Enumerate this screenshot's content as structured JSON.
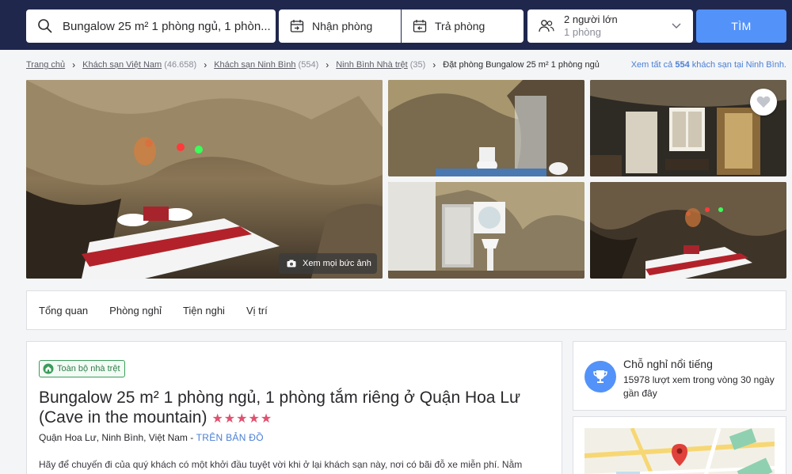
{
  "search": {
    "destination": "Bungalow 25 m² 1 phòng ngủ, 1 phòn...",
    "checkin_label": "Nhận phòng",
    "checkout_label": "Trả phòng",
    "guests_line1": "2 người lớn",
    "guests_line2": "1 phòng",
    "search_button": "TÌM",
    "icons": {
      "search": "search-icon",
      "calendar": "calendar-icon",
      "guests": "guests-icon",
      "dropdown": "chevron-down-icon"
    }
  },
  "breadcrumb": {
    "items": [
      {
        "label": "Trang chủ",
        "count": ""
      },
      {
        "label": "Khách sạn Việt Nam",
        "count": "(46.658)"
      },
      {
        "label": "Khách sạn Ninh Bình",
        "count": "(554)"
      },
      {
        "label": "Ninh Bình Nhà trệt",
        "count": "(35)"
      }
    ],
    "current": "Đặt phòng Bungalow 25 m² 1 phòng ngủ",
    "see_all_prefix": "Xem tất cả",
    "see_all_count": "554",
    "see_all_suffix": "khách sạn tại Ninh Bình."
  },
  "gallery": {
    "see_all_photos": "Xem mọi bức ảnh",
    "favorite_icon": "heart-icon",
    "camera_icon": "camera-icon"
  },
  "tabs": [
    "Tổng quan",
    "Phòng nghỉ",
    "Tiện nghi",
    "Vị trí"
  ],
  "property": {
    "badge": "Toàn bộ nhà trệt",
    "title": "Bungalow 25 m² 1 phòng ngủ, 1 phòng tắm riêng ở Quận Hoa Lư (Cave in the mountain)",
    "stars": "★★★★★",
    "star_rating": 5,
    "address": "Quận Hoa Lư, Ninh Bình, Việt Nam",
    "address_separator": " - ",
    "map_link": "TRÊN BẢN ĐỒ",
    "description_line1": "Hãy để chuyến đi của quý khách có một khởi đầu tuyệt vời khi ở lại khách sạn này, nơi có bãi đỗ xe miễn phí. Nằm"
  },
  "popular": {
    "title": "Chỗ nghỉ nổi tiếng",
    "subtitle": "15978 lượt xem trong vòng 30 ngày gần đây",
    "icon": "trophy-icon"
  },
  "colors": {
    "header_bg": "#20274d",
    "accent": "#5392f9",
    "stars": "#e0516f",
    "badge_green": "#2f7d4a",
    "link": "#4a7fd6"
  }
}
